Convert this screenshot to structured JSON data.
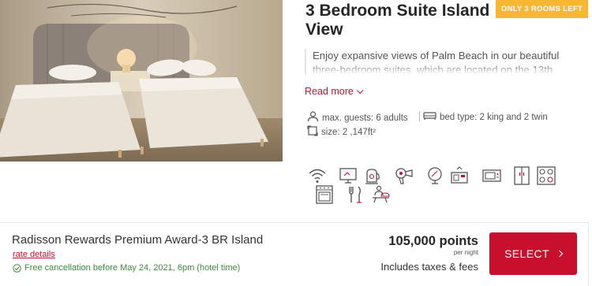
{
  "room": {
    "title": "3 Bedroom Suite Island View",
    "badge": "ONLY 3 ROOMS LEFT",
    "description": "Enjoy expansive views of Palm Beach in our beautiful three-bedroom suites, which are located on the 13th",
    "read_more": "Read more",
    "max_guests": "max. guests: 6 adults",
    "bed_type": "bed type: 2 king and 2 twin",
    "size": "size: 2 ,147ft²"
  },
  "amenities": [
    "wifi-icon",
    "tv-icon",
    "kettle-icon",
    "hairdryer-icon",
    "mirror-icon",
    "safe-icon",
    "microwave-icon",
    "refrigerator-icon",
    "stove-icon",
    "oven-icon",
    "dining-icon",
    "room-service-icon"
  ],
  "rate": {
    "name": "Radisson Rewards Premium Award-3 BR Island",
    "details_link": "rate details",
    "cancellation": "Free cancellation before May 24, 2021, 6pm (hotel time)",
    "points": "105,000 points",
    "per_night": "per night",
    "taxes": "Includes taxes & fees",
    "select_label": "SELECT"
  },
  "colors": {
    "accent": "#c8102e",
    "badge": "#f7b733",
    "success": "#3a8f3a"
  }
}
